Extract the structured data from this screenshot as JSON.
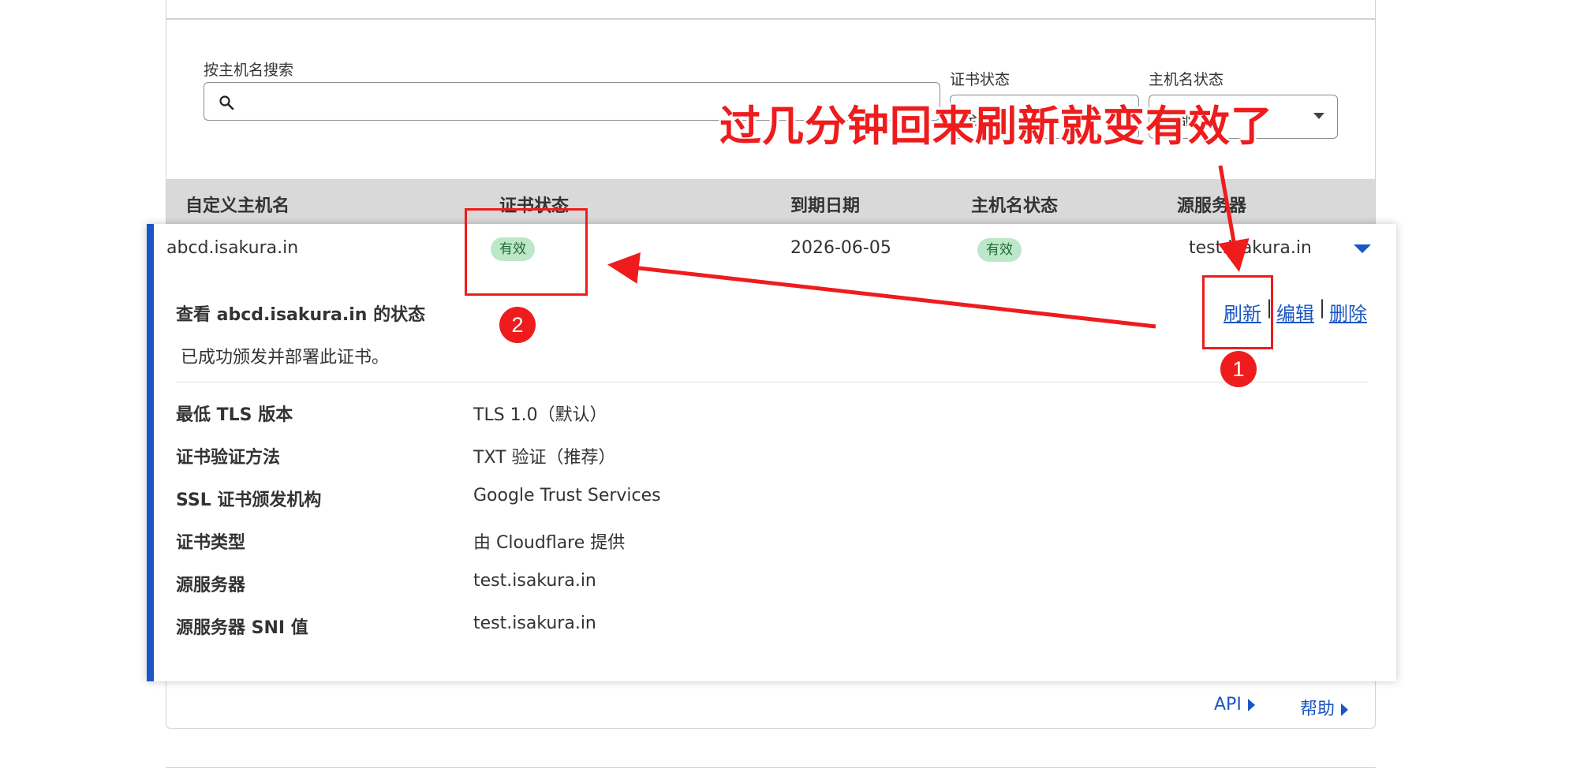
{
  "search": {
    "label": "按主机名搜索",
    "placeholder": "",
    "cert_status_label": "证书状态",
    "cert_status_value": "全部",
    "hostname_status_label": "主机名状态",
    "hostname_status_value": "全部"
  },
  "table": {
    "headers": [
      "自定义主机名",
      "证书状态",
      "到期日期",
      "主机名状态",
      "源服务器"
    ],
    "row": {
      "hostname": "abcd.isakura.in",
      "cert_status": "有效",
      "expiry": "2026-06-05",
      "hostname_status": "有效",
      "origin": "test.isakura.in"
    }
  },
  "detail": {
    "title": "查看 abcd.isakura.in 的状态",
    "message": "已成功颁发并部署此证书。",
    "actions": {
      "refresh": "刷新",
      "edit": "编辑",
      "delete": "删除",
      "separator": "|"
    },
    "fields": [
      {
        "label": "最低 TLS 版本",
        "value": "TLS 1.0（默认）"
      },
      {
        "label": "证书验证方法",
        "value": "TXT 验证（推荐）"
      },
      {
        "label": "SSL 证书颁发机构",
        "value": "Google Trust Services"
      },
      {
        "label": "证书类型",
        "value": "由 Cloudflare 提供"
      },
      {
        "label": "源服务器",
        "value": "test.isakura.in"
      },
      {
        "label": "源服务器 SNI 值",
        "value": "test.isakura.in"
      }
    ]
  },
  "footer": {
    "api": "API",
    "help": "帮助"
  },
  "annotation": {
    "note": "过几分钟回来刷新就变有效了",
    "step1": "1",
    "step2": "2",
    "color": "#ee1c1c"
  },
  "colors": {
    "accent": "#1a56c4",
    "badge_bg": "#bde7c9",
    "badge_text": "#1f6b34"
  }
}
